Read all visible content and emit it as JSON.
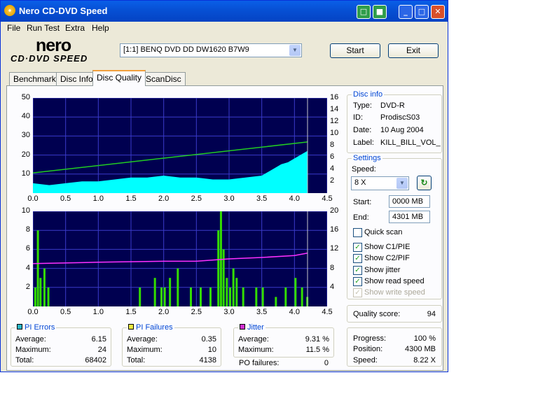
{
  "window": {
    "title": "Nero CD-DVD Speed",
    "title_buttons": [
      "copy-icon",
      "save-icon",
      "minimize-icon",
      "maximize-icon",
      "close-icon"
    ]
  },
  "menu": [
    "File",
    "Run Test",
    "Extra",
    "Help"
  ],
  "logo": {
    "line1": "nero",
    "line2": "CD·DVD SPEED"
  },
  "drive": {
    "selected": "[1:1]   BENQ DVD DD DW1620 B7W9"
  },
  "buttons": {
    "start": "Start",
    "exit": "Exit"
  },
  "tabs": [
    {
      "label": "Benchmark",
      "active": false
    },
    {
      "label": "Disc Info",
      "active": false
    },
    {
      "label": "Disc Quality",
      "active": true
    },
    {
      "label": "ScanDisc",
      "active": false
    }
  ],
  "disc_info": {
    "title": "Disc info",
    "rows": [
      {
        "label": "Type:",
        "value": "DVD-R"
      },
      {
        "label": "ID:",
        "value": "ProdiscS03"
      },
      {
        "label": "Date:",
        "value": "10 Aug 2004"
      },
      {
        "label": "Label:",
        "value": "KILL_BILL_VOL_"
      }
    ]
  },
  "settings": {
    "title": "Settings",
    "speed_label": "Speed:",
    "speed_value": "8 X",
    "start_label": "Start:",
    "start_value": "0000 MB",
    "end_label": "End:",
    "end_value": "4301 MB",
    "checkboxes": [
      {
        "label": "Quick scan",
        "checked": false,
        "disabled": false
      },
      {
        "label": "Show C1/PIE",
        "checked": true,
        "disabled": false
      },
      {
        "label": "Show C2/PIF",
        "checked": true,
        "disabled": false
      },
      {
        "label": "Show jitter",
        "checked": true,
        "disabled": false
      },
      {
        "label": "Show read speed",
        "checked": true,
        "disabled": false
      },
      {
        "label": "Show write speed",
        "checked": true,
        "disabled": true
      }
    ]
  },
  "quality": {
    "label": "Quality score:",
    "value": "94"
  },
  "progress": {
    "rows": [
      {
        "label": "Progress:",
        "value": "100 %"
      },
      {
        "label": "Position:",
        "value": "4300 MB"
      },
      {
        "label": "Speed:",
        "value": "8.22 X"
      }
    ]
  },
  "pi_errors": {
    "title": "PI Errors",
    "color": "#2bb8c8",
    "rows": [
      {
        "label": "Average:",
        "value": "6.15"
      },
      {
        "label": "Maximum:",
        "value": "24"
      },
      {
        "label": "Total:",
        "value": "68402"
      }
    ]
  },
  "pi_failures": {
    "title": "PI Failures",
    "color": "#e8e840",
    "rows": [
      {
        "label": "Average:",
        "value": "0.35"
      },
      {
        "label": "Maximum:",
        "value": "10"
      },
      {
        "label": "Total:",
        "value": "4138"
      }
    ]
  },
  "jitter": {
    "title": "Jitter",
    "color": "#d030d0",
    "rows": [
      {
        "label": "Average:",
        "value": "9.31 %"
      },
      {
        "label": "Maximum:",
        "value": "11.5 %"
      }
    ]
  },
  "po_failures": {
    "label": "PO failures:",
    "value": "0"
  },
  "colors": {
    "plot_bg": "#000050",
    "grid": "#3a3ac8",
    "pie": "#00ffff",
    "pif": "#33dd00",
    "jitter": "#ff30ff",
    "speed": "#22cc22",
    "marker": "#c8c8c8"
  },
  "chart_data": [
    {
      "type": "area",
      "x_ticks": [
        "0.0",
        "0.5",
        "1.0",
        "1.5",
        "2.0",
        "2.5",
        "3.0",
        "3.5",
        "4.0",
        "4.5"
      ],
      "y_left_ticks": [
        "50",
        "40",
        "30",
        "20",
        "10"
      ],
      "y_right_ticks": [
        "16",
        "14",
        "12",
        "10",
        "8",
        "6",
        "4",
        "2"
      ],
      "xlim": [
        0,
        4.5
      ],
      "ylim_left": [
        0,
        50
      ],
      "ylim_right": [
        0,
        16
      ],
      "series": [
        {
          "x": [
            0.0,
            0.25,
            0.5,
            0.75,
            1.0,
            1.25,
            1.5,
            1.75,
            2.0,
            2.25,
            2.5,
            2.75,
            3.0,
            3.25,
            3.5,
            3.65,
            3.8,
            3.9,
            4.0,
            4.1,
            4.2
          ],
          "values": [
            5,
            4,
            5,
            6,
            6,
            7,
            8,
            8,
            9,
            8,
            8,
            7,
            7,
            8,
            9,
            12,
            15,
            16,
            18,
            20,
            22
          ]
        },
        {
          "x": [
            0.0,
            4.2
          ],
          "values": [
            3.4,
            8.6
          ]
        }
      ]
    },
    {
      "type": "bar",
      "x_ticks": [
        "0.0",
        "0.5",
        "1.0",
        "1.5",
        "2.0",
        "2.5",
        "3.0",
        "3.5",
        "4.0",
        "4.5"
      ],
      "y_left_ticks": [
        "10",
        "8",
        "6",
        "4",
        "2"
      ],
      "y_right_ticks": [
        "20",
        "16",
        "12",
        "8",
        "4"
      ],
      "xlim": [
        0,
        4.5
      ],
      "ylim_left": [
        0,
        10
      ],
      "ylim_right": [
        0,
        20
      ],
      "series": [
        {
          "x": [
            0.02,
            0.06,
            0.1,
            0.16,
            0.22,
            1.62,
            1.85,
            1.95,
            2.0,
            2.08,
            2.2,
            2.4,
            2.55,
            2.7,
            2.82,
            2.86,
            2.9,
            2.95,
            3.0,
            3.05,
            3.1,
            3.2,
            3.4,
            3.5,
            3.7,
            3.85,
            4.0,
            4.1,
            4.18
          ],
          "values": [
            2,
            8,
            3,
            4,
            2,
            2,
            3,
            2,
            2,
            3,
            4,
            2,
            2,
            2,
            8,
            10,
            6,
            3,
            2,
            4,
            3,
            2,
            2,
            2,
            1,
            2,
            3,
            2,
            1
          ]
        },
        {
          "x": [
            0.0,
            1.0,
            2.0,
            2.5,
            3.0,
            3.5,
            4.0,
            4.2
          ],
          "values": [
            9,
            9.3,
            9.5,
            9.5,
            10,
            10.3,
            10.7,
            11.2
          ]
        }
      ]
    }
  ]
}
